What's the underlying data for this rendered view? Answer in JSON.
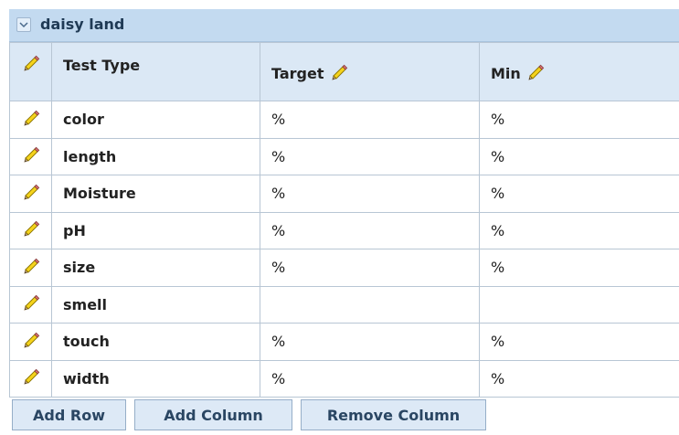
{
  "group": {
    "title": "daisy land",
    "toggle_icon": "chevron-down-icon"
  },
  "columns": {
    "test_type": "Test Type",
    "target": "Target",
    "min": "Min"
  },
  "rows": [
    {
      "type": "color",
      "target": "%",
      "min": "%"
    },
    {
      "type": "length",
      "target": "%",
      "min": "%"
    },
    {
      "type": "Moisture",
      "target": "%",
      "min": "%"
    },
    {
      "type": "pH",
      "target": "%",
      "min": "%"
    },
    {
      "type": "size",
      "target": "%",
      "min": "%"
    },
    {
      "type": "smell",
      "target": "",
      "min": ""
    },
    {
      "type": "touch",
      "target": "%",
      "min": "%"
    },
    {
      "type": "width",
      "target": "%",
      "min": "%"
    }
  ],
  "buttons": {
    "add_row": "Add Row",
    "add_column": "Add Column",
    "remove_column": "Remove Column"
  },
  "colors": {
    "header_bg": "#c3daf0",
    "column_header_bg": "#dbe8f5",
    "grid_border": "#b8c6d4",
    "button_bg": "#dde9f6"
  }
}
